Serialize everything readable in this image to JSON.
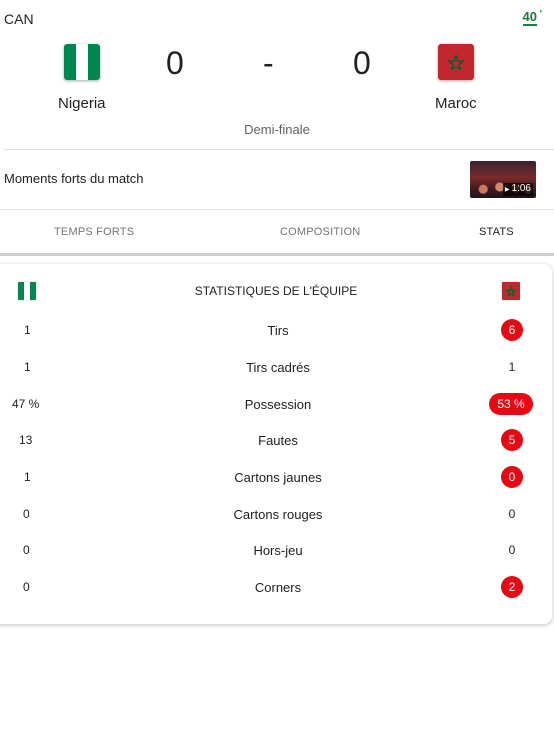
{
  "match": {
    "competition": "CAN",
    "minute": "40",
    "minute_tick": "'",
    "stage": "Demi-finale",
    "home": {
      "name": "Nigeria",
      "score": "0",
      "flag": "nigeria-flag",
      "flag_colors": [
        "#008751",
        "#ffffff",
        "#008751"
      ]
    },
    "away": {
      "name": "Maroc",
      "score": "0",
      "flag": "morocco-flag",
      "flag_colors": [
        "#c1272d",
        "#006233"
      ]
    },
    "separator": "-"
  },
  "highlights": {
    "label": "Moments forts du match",
    "duration": "1:06"
  },
  "tabs": [
    {
      "label": "TEMPS FORTS",
      "active": false
    },
    {
      "label": "COMPOSITION",
      "active": false
    },
    {
      "label": "STATS",
      "active": true
    }
  ],
  "stats": {
    "title": "STATISTIQUES DE L'ÉQUIPE",
    "highlight_color": "#e50914",
    "rows": [
      {
        "label": "Tirs",
        "home": "1",
        "away": "6",
        "away_highlight": true
      },
      {
        "label": "Tirs cadrés",
        "home": "1",
        "away": "1",
        "away_highlight": false
      },
      {
        "label": "Possession",
        "home": "47 %",
        "away": "53 %",
        "away_highlight": true
      },
      {
        "label": "Fautes",
        "home": "13",
        "away": "5",
        "away_highlight": true
      },
      {
        "label": "Cartons jaunes",
        "home": "1",
        "away": "0",
        "away_highlight": true
      },
      {
        "label": "Cartons rouges",
        "home": "0",
        "away": "0",
        "away_highlight": false
      },
      {
        "label": "Hors-jeu",
        "home": "0",
        "away": "0",
        "away_highlight": false
      },
      {
        "label": "Corners",
        "home": "0",
        "away": "2",
        "away_highlight": true
      }
    ]
  }
}
